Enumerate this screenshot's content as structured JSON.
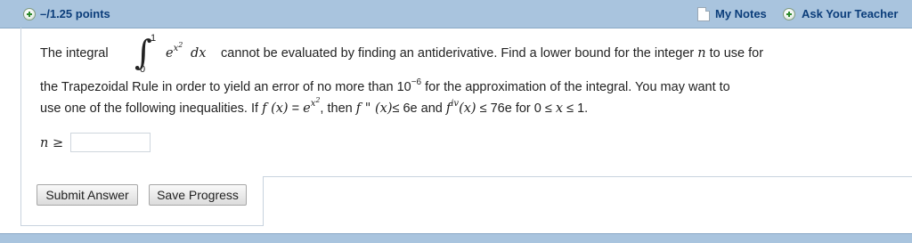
{
  "header": {
    "points": "–/1.25 points",
    "my_notes": "My Notes",
    "ask_teacher": "Ask Your Teacher"
  },
  "question": {
    "intro": "The integral",
    "upper_limit": "1",
    "lower_limit": "0",
    "integrand_base": "e",
    "integrand_exp": "x",
    "integrand_exp2": "2",
    "dx": "dx",
    "line1_rest": "cannot be evaluated by finding an antiderivative. Find a lower bound for the integer",
    "n_var": "n",
    "line1_end": "to use for",
    "line2_a": "the Trapezoidal Rule in order to yield an error of no more than 10",
    "line2_exp": "−6",
    "line2_b": "for the approximation of the integral. You may want to",
    "line3_a": "use one of the following inequalities. If",
    "line3_fx": "f (x)",
    "line3_eq": "=",
    "line3_e": "e",
    "line3_exp": "x",
    "line3_exp2": "2",
    "line3_then": ", then",
    "line3_f2": "f \" (x)",
    "line3_le1": "≤ 6e and",
    "line3_fiv": "f",
    "line3_iv": "iv",
    "line3_x": "(x)",
    "line3_rest": "≤ 76e for 0 ≤",
    "line3_xvar": "x",
    "line3_end": "≤ 1."
  },
  "answer": {
    "label": "n ≥",
    "value": "",
    "placeholder": ""
  },
  "buttons": {
    "submit": "Submit Answer",
    "save": "Save Progress"
  }
}
